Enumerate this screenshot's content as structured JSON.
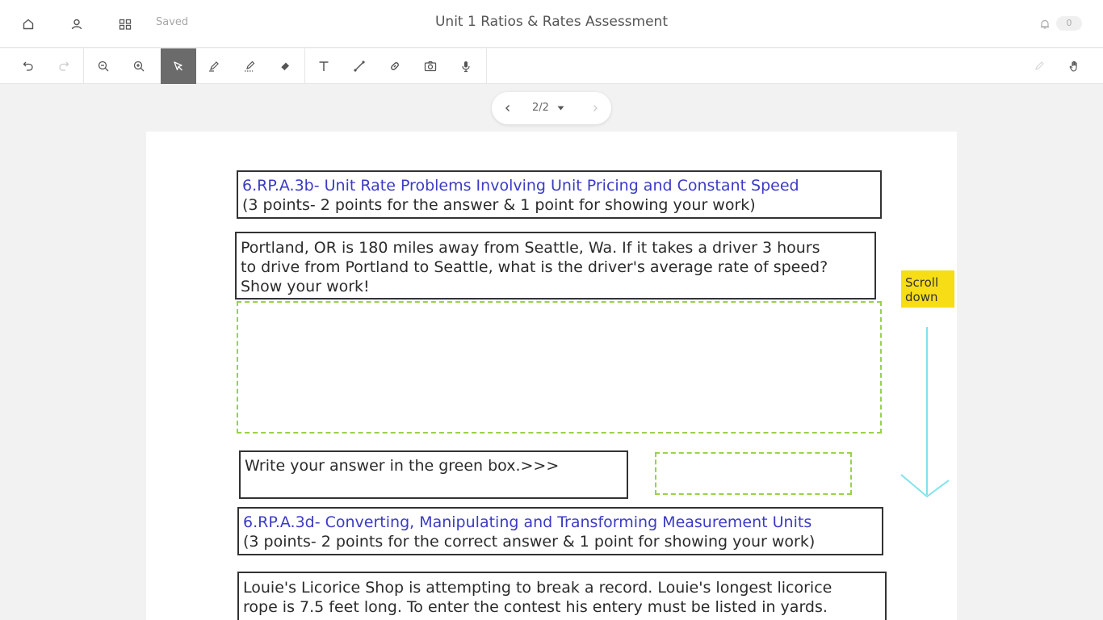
{
  "topbar": {
    "home_icon": "home-icon",
    "profile_icon": "profile-icon",
    "grid_icon": "grid-icon",
    "saved_status": "Saved",
    "title": "Unit 1 Ratios & Rates Assessment",
    "bell_icon": "bell-icon",
    "notification_count": "0"
  },
  "toolbar": {
    "tools": [
      "undo-icon",
      "redo-icon",
      "zoom-out-icon",
      "zoom-in-icon",
      "select-cursor-icon",
      "pen-icon",
      "highlighter-icon",
      "eraser-icon",
      "text-icon",
      "line-icon",
      "link-icon",
      "camera-icon",
      "microphone-icon",
      "pencil-disabled-icon",
      "hand-pan-icon"
    ],
    "active_tool": "select-cursor-icon",
    "active_color": "#6b6b6b"
  },
  "pager": {
    "label": "2/2",
    "current_page": 2,
    "total_pages": 2
  },
  "page": {
    "section1": {
      "heading": "6.RP.A.3b- Unit Rate Problems Involving Unit Pricing and Constant Speed",
      "points": "(3 points- 2 points for the answer & 1 point for showing your work)"
    },
    "question1": {
      "line1": "Portland, OR is 180 miles away from Seattle, Wa.  If it takes a driver 3 hours",
      "line2": "to drive from Portland to Seattle, what is the driver's average rate of speed?",
      "line3": "Show your work!"
    },
    "answer_prompt": "Write your answer in the green box.>>>",
    "section2": {
      "heading": "6.RP.A.3d- Converting, Manipulating and Transforming Measurement Units",
      "points": "(3 points- 2 points for the correct answer & 1 point for showing your work)"
    },
    "question2": {
      "line1": "Louie's Licorice Shop is attempting to break a record.  Louie's longest licorice",
      "line2": "rope is 7.5 feet long.  To enter the contest his entery must be listed in yards."
    },
    "sticky_note": {
      "line1": "Scroll",
      "line2": "down",
      "color": "#f7dd16"
    },
    "arrow_color": "#7fe3ea",
    "green_box_color": "#9ad14b",
    "heading_color": "#3b3bc6"
  }
}
